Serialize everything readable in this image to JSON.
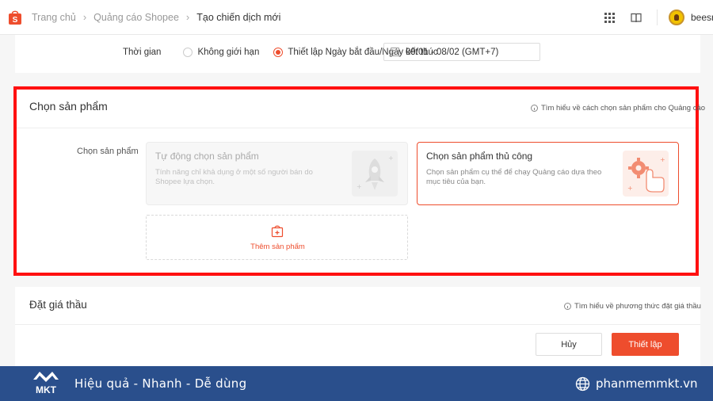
{
  "breadcrumb": {
    "items": [
      "Trang chủ",
      "Quảng cáo Shopee",
      "Tạo chiến dịch mới"
    ]
  },
  "header": {
    "username": "beesn",
    "icons": [
      "apps-grid-icon",
      "book-icon"
    ]
  },
  "time_section": {
    "label": "Thời gian",
    "options": [
      "Không giới hạn",
      "Thiết lập Ngày bắt đầu/Ngày kết thúc"
    ],
    "selected_index": 1,
    "date_range": "09/01 - 08/02 (GMT+7)"
  },
  "product_section": {
    "title": "Chọn sản phẩm",
    "help_link": "Tìm hiểu về cách chọn sản phẩm cho Quảng cáo",
    "field_label": "Chọn sản phẩm",
    "auto_option": {
      "title": "Tự động chọn sản phẩm",
      "description": "Tính năng chỉ khả dụng ở một số người bán do Shopee lựa chọn."
    },
    "manual_option": {
      "title": "Chọn sản phẩm thủ công",
      "description": "Chọn sản phẩm cụ thể để chạy Quảng cáo dựa theo mục tiêu của bạn."
    },
    "add_button": "Thêm sản phẩm"
  },
  "bid_section": {
    "title": "Đặt giá thầu",
    "help_link": "Tìm hiểu về phương thức đặt giá thầu"
  },
  "actions": {
    "cancel": "Hủy",
    "submit": "Thiết lập"
  },
  "banner": {
    "logo_text": "MKT",
    "slogan": "Hiệu quả - Nhanh - Dễ dùng",
    "website": "phanmemmkt.vn"
  },
  "colors": {
    "accent": "#ee4d2d",
    "highlight_border": "#ff1010",
    "banner_bg": "#2a4f8c"
  }
}
